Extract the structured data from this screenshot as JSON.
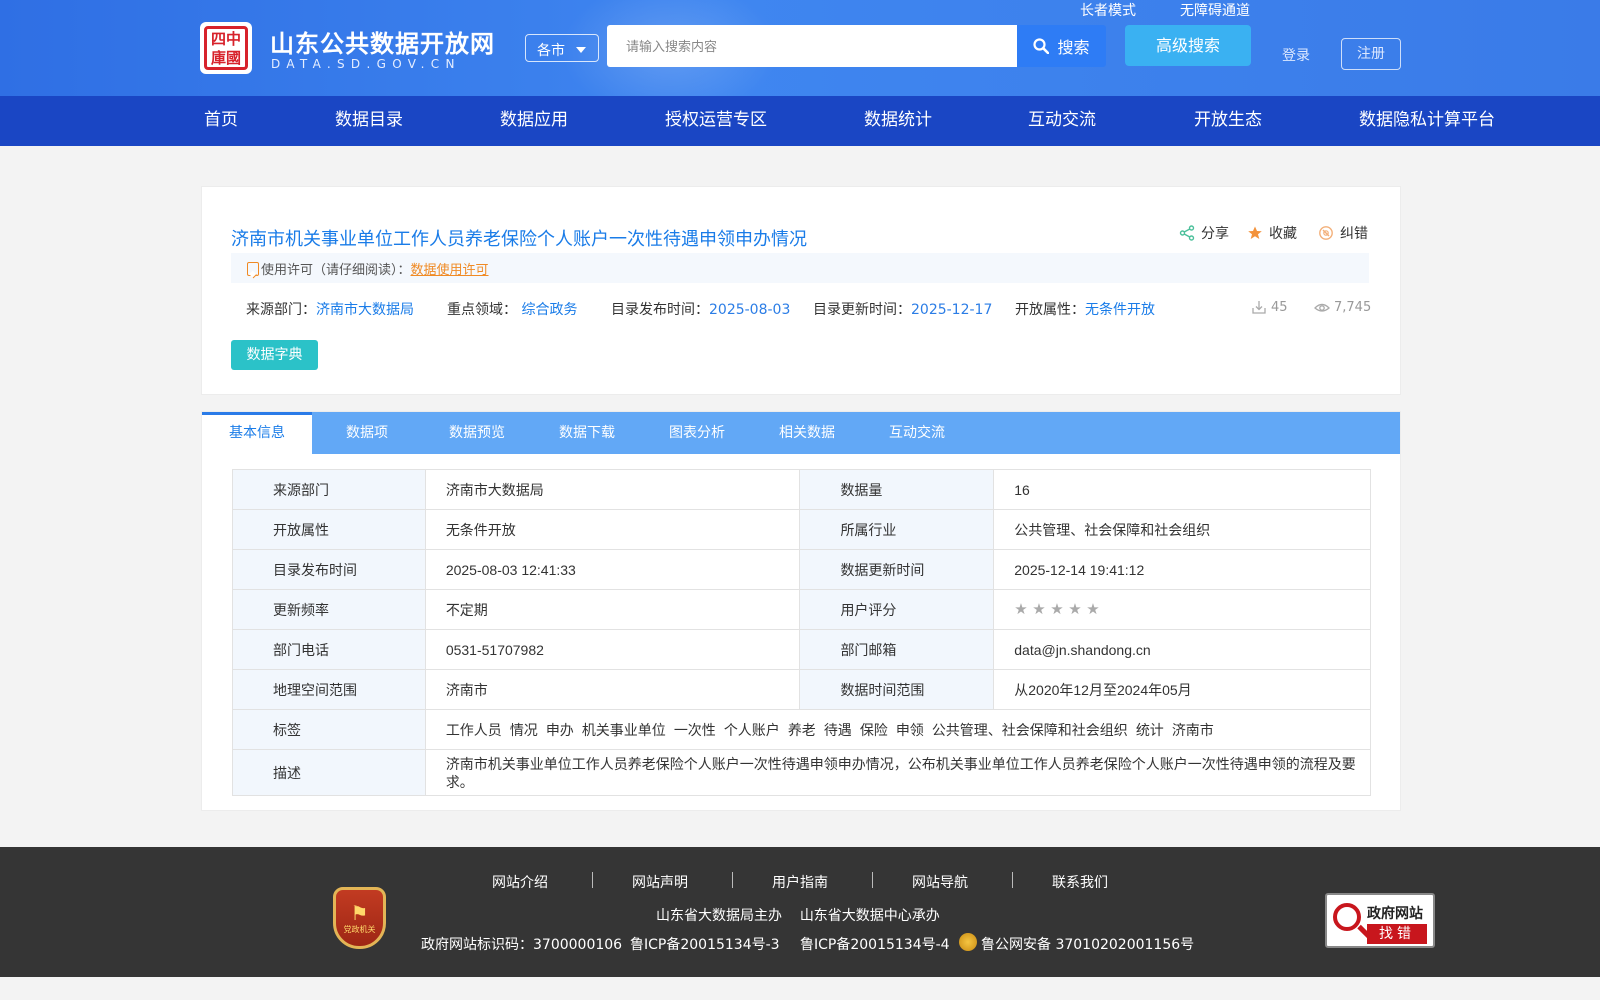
{
  "header": {
    "logo_seal_text": "中國四庫",
    "site_title": "山东公共数据开放网",
    "site_domain": "DATA.SD.GOV.CN",
    "city_select": "各市",
    "search_placeholder": "请输入搜索内容",
    "search_button": "搜索",
    "advanced_search": "高级搜索",
    "elder_mode": "长者模式",
    "accessibility": "无障碍通道",
    "login": "登录",
    "register": "注册"
  },
  "nav": [
    "首页",
    "数据目录",
    "数据应用",
    "授权运营专区",
    "数据统计",
    "互动交流",
    "开放生态",
    "数据隐私计算平台"
  ],
  "dataset": {
    "title": "济南市机关事业单位工作人员养老保险个人账户一次性待遇申领申办情况",
    "actions": {
      "share": "分享",
      "favorite": "收藏",
      "report": "纠错"
    },
    "license_label": "使用许可（请仔细阅读）：",
    "license_link": "数据使用许可",
    "meta": {
      "source_label": "来源部门：",
      "source_value": "济南市大数据局",
      "field_label": "重点领域：",
      "field_value": "综合政务",
      "pub_label": "目录发布时间：",
      "pub_value": "2025-08-03",
      "upd_label": "目录更新时间：",
      "upd_value": "2025-12-17",
      "open_label": "开放属性：",
      "open_value": "无条件开放"
    },
    "downloads": "45",
    "views": "7,745",
    "dict_button": "数据字典"
  },
  "tabs": [
    "基本信息",
    "数据项",
    "数据预览",
    "数据下载",
    "图表分析",
    "相关数据",
    "互动交流"
  ],
  "info": {
    "rows": [
      [
        "来源部门",
        "济南市大数据局",
        "数据量",
        "16"
      ],
      [
        "开放属性",
        "无条件开放",
        "所属行业",
        "公共管理、社会保障和社会组织"
      ],
      [
        "目录发布时间",
        "2025-08-03 12:41:33",
        "数据更新时间",
        "2025-12-14 19:41:12"
      ],
      [
        "更新频率",
        "不定期",
        "用户评分",
        ""
      ],
      [
        "部门电话",
        "0531-51707982",
        "部门邮箱",
        "data@jn.shandong.cn"
      ],
      [
        "地理空间范围",
        "济南市",
        "数据时间范围",
        "从2020年12月至2024年05月"
      ]
    ],
    "rating": 0,
    "rating_max": 5,
    "tags_label": "标签",
    "tags": [
      "工作人员",
      "情况",
      "申办",
      "机关事业单位",
      "一次性",
      "个人账户",
      "养老",
      "待遇",
      "保险",
      "申领",
      "公共管理、社会保障和社会组织",
      "统计",
      "济南市"
    ],
    "desc_label": "描述",
    "desc": "济南市机关事业单位工作人员养老保险个人账户一次性待遇申领申办情况，公布机关事业单位工作人员养老保险个人账户一次性待遇申领的流程及要求。"
  },
  "footer": {
    "badge_text": "党政机关",
    "links": [
      "网站介绍",
      "网站声明",
      "用户指南",
      "网站导航",
      "联系我们"
    ],
    "sponsor": "山东省大数据局主办",
    "organizer": "山东省大数据中心承办",
    "gov_id": "政府网站标识码：3700000106",
    "icp1": "鲁ICP备20015134号-3",
    "icp2": "鲁ICP备20015134号-4",
    "police": "鲁公网安备 37010202001156号",
    "gov_error_line1": "政府网站",
    "gov_error_line2": "找错"
  }
}
